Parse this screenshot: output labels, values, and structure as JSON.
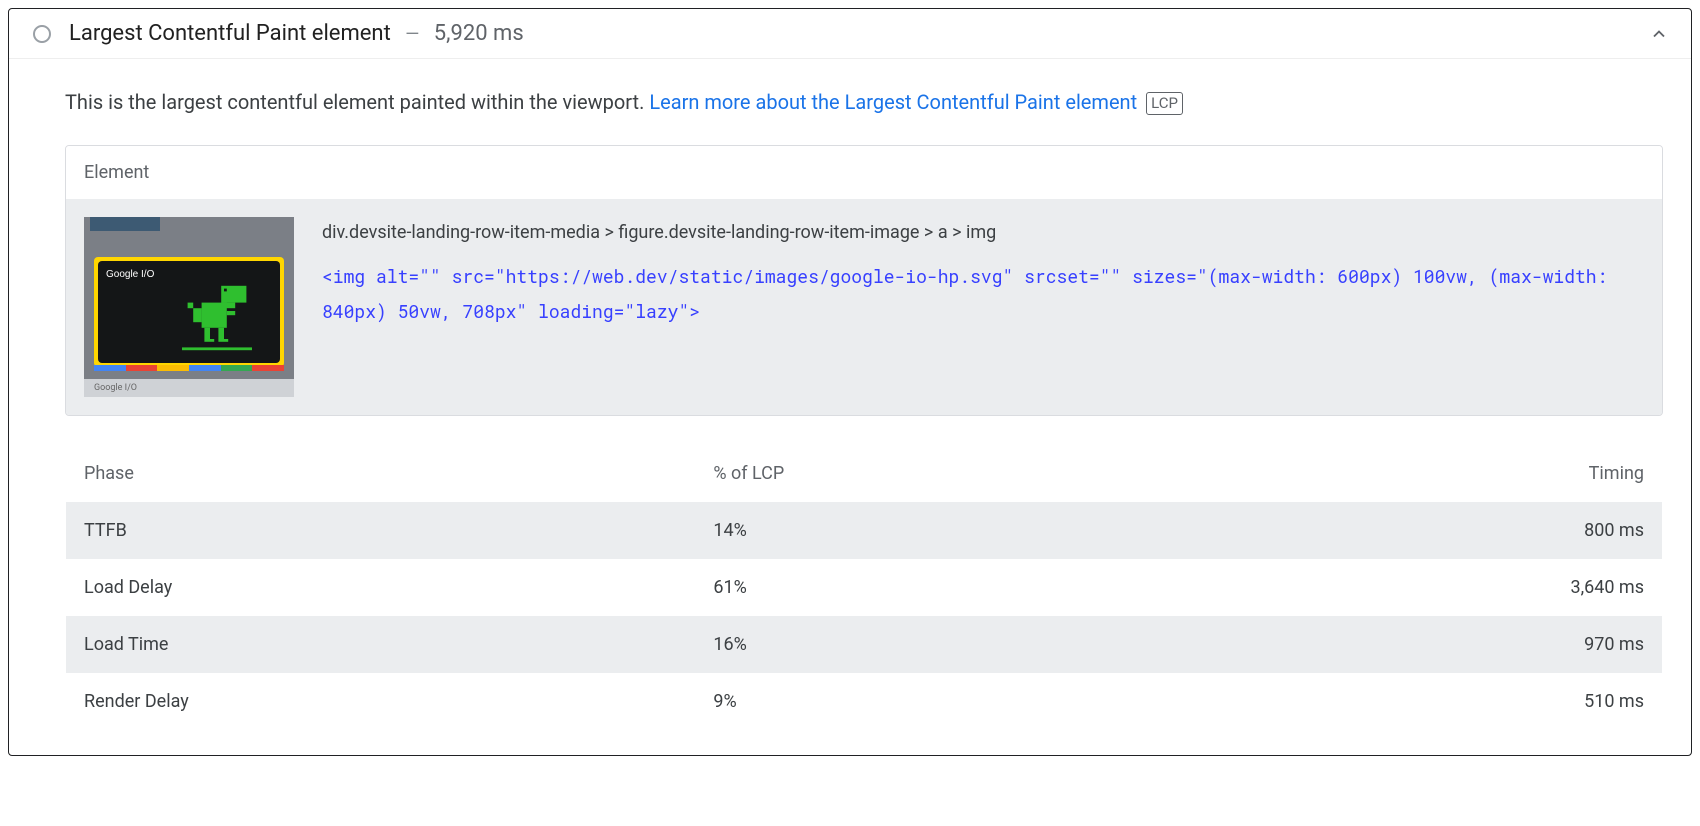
{
  "header": {
    "title": "Largest Contentful Paint element",
    "sep": "—",
    "time": "5,920 ms"
  },
  "description": {
    "intro": "This is the largest contentful element painted within the viewport. ",
    "link_text": "Learn more about the Largest Contentful Paint element",
    "badge": "LCP"
  },
  "element_box": {
    "heading": "Element",
    "selector": "div.devsite-landing-row-item-media > figure.devsite-landing-row-item-image > a > img",
    "snippet": "<img alt=\"\" src=\"https://web.dev/static/images/google-io-hp.svg\" srcset=\"\" sizes=\"(max-width: 600px) 100vw, (max-width: 840px) 50vw, 708px\" loading=\"lazy\">",
    "thumb_label": "Google I/O",
    "thumb_footer": "Google I/O"
  },
  "phase_table": {
    "headers": {
      "phase": "Phase",
      "pct": "% of LCP",
      "timing": "Timing"
    },
    "rows": [
      {
        "phase": "TTFB",
        "pct": "14%",
        "timing": "800 ms"
      },
      {
        "phase": "Load Delay",
        "pct": "61%",
        "timing": "3,640 ms"
      },
      {
        "phase": "Load Time",
        "pct": "16%",
        "timing": "970 ms"
      },
      {
        "phase": "Render Delay",
        "pct": "9%",
        "timing": "510 ms"
      }
    ]
  }
}
